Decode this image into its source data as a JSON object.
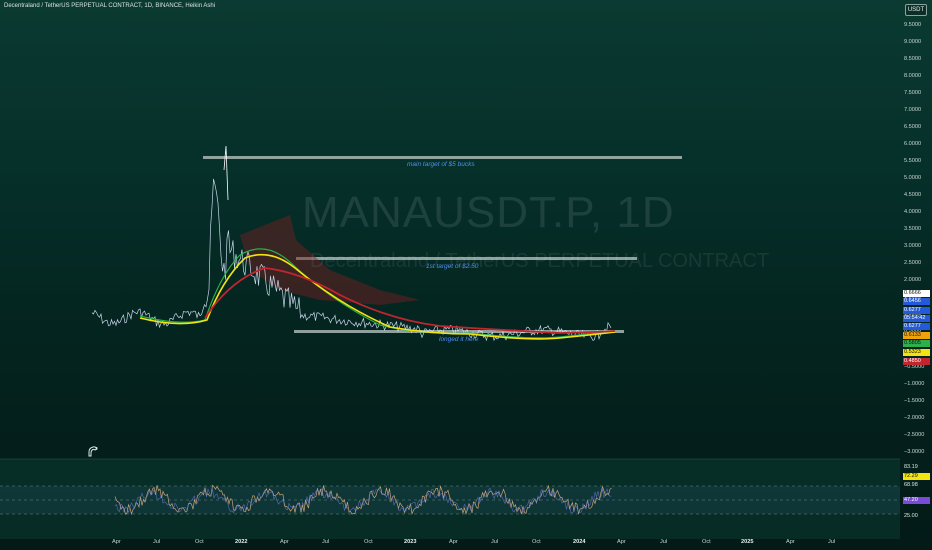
{
  "header": {
    "title": "Decentraland / TetherUS PERPETUAL CONTRACT, 1D, BINANCE, Heikin Ashi",
    "currency_button": "USDT"
  },
  "watermark": {
    "symbol": "MANAUSDT.P, 1D",
    "description": "Decentraland / TetherUS PERPETUAL CONTRACT"
  },
  "annotations": {
    "main_target": "main target of $5 bucks",
    "first_target": "1st target of $2.50",
    "entry": "longed it here"
  },
  "price_axis": [
    "9.5000",
    "9.0000",
    "8.5000",
    "8.0000",
    "7.5000",
    "7.0000",
    "6.5000",
    "6.0000",
    "5.5000",
    "5.0000",
    "4.5000",
    "4.0000",
    "3.5000",
    "3.0000",
    "2.5000",
    "2.0000",
    "1.5000",
    "1.0000",
    "0.5000",
    "−0.5000",
    "−1.0000",
    "−1.5000",
    "−2.0000",
    "−2.5000",
    "−3.0000"
  ],
  "price_badges": [
    {
      "text": "0.6666",
      "bg": "#ffffff",
      "fg": "#111111"
    },
    {
      "text": "0.6456",
      "bg": "#2459d8",
      "fg": "#ffffff"
    },
    {
      "text": "0.6277",
      "bg": "#2459d8",
      "fg": "#ffffff"
    },
    {
      "text": "05:54:42",
      "bg": "#2459d8",
      "fg": "#ffffff"
    },
    {
      "text": "0.6277",
      "bg": "#2459d8",
      "fg": "#ffffff"
    },
    {
      "text": "0.6133",
      "bg": "#f0a20a",
      "fg": "#111111"
    },
    {
      "text": "0.5805",
      "bg": "#2bb04a",
      "fg": "#111111"
    },
    {
      "text": "0.5323",
      "bg": "#f2e311",
      "fg": "#111111"
    },
    {
      "text": "0.4850",
      "bg": "#c3252f",
      "fg": "#ffffff"
    }
  ],
  "rsi_axis": [
    "83.19",
    "72.29",
    "68.98",
    "47.20",
    "25.00"
  ],
  "rsi_badge_colors": [
    "#ffffff",
    "#f2e311",
    "#ffffff",
    "#7a4ad8",
    "#ffffff"
  ],
  "time_axis": [
    "Apr",
    "Jul",
    "Oct",
    "2022",
    "Apr",
    "Jul",
    "Oct",
    "2023",
    "Apr",
    "Jul",
    "Oct",
    "2024",
    "Apr",
    "Jul",
    "Oct",
    "2025",
    "Apr",
    "Jul"
  ],
  "colors": {
    "price": "#dce8ff",
    "ma_yellow": "#f2e311",
    "ma_green": "#2bb04a",
    "ma_red": "#c3252f",
    "rsi": "#c8a27a",
    "annotation": "#4d8ff5"
  }
}
